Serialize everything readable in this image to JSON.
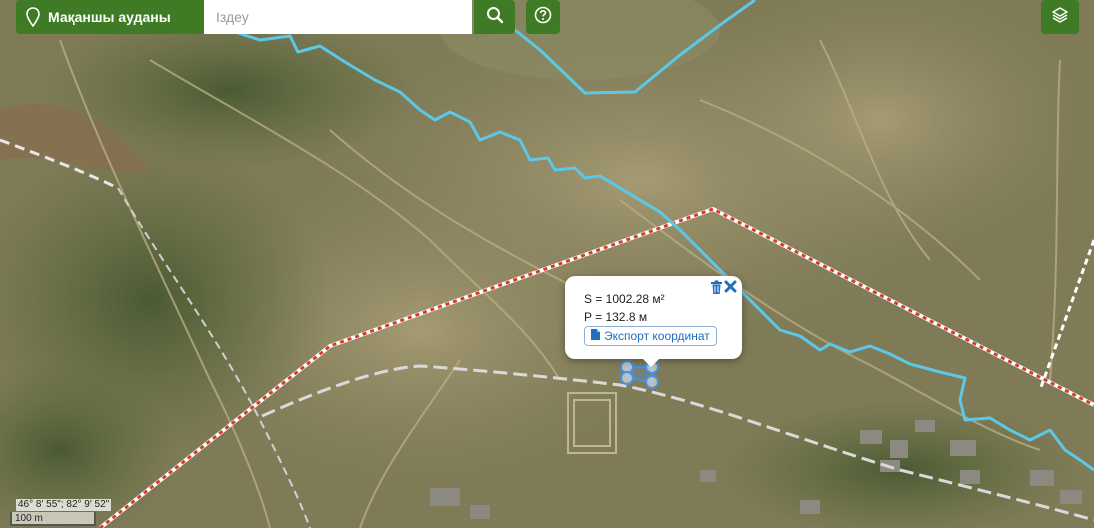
{
  "region_button": {
    "label": "Мақаншы ауданы",
    "icon": "map-pin-icon"
  },
  "search": {
    "placeholder": "Іздеу",
    "icon": "search-icon"
  },
  "help_button": {
    "icon": "question-circle-icon"
  },
  "layers_button": {
    "icon": "layers-icon"
  },
  "popup": {
    "area_line": "S = 1002.28 м²",
    "perimeter_line": "P = 132.8 м",
    "export_label": "Экспорт координат",
    "delete_icon": "trash-icon",
    "close_icon": "close-icon"
  },
  "coordinates": "46° 8' 55\"; 82° 9' 52\"",
  "scale": "100 m",
  "colors": {
    "brand": "#3f7a25",
    "river": "#5cc8e8",
    "boundary": "#d93a2a",
    "road": "#cfcfcf"
  }
}
